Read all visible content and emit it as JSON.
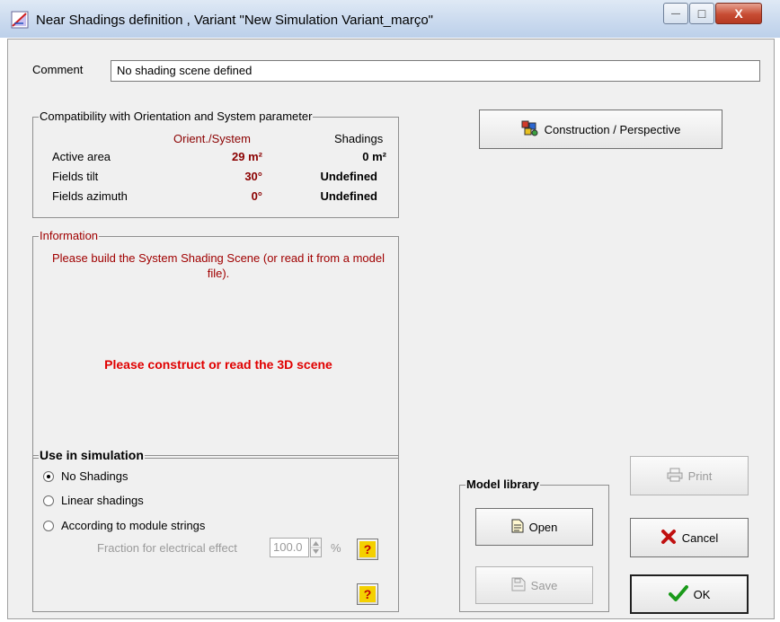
{
  "window": {
    "title": "Near Shadings definition , Variant \"New Simulation Variant_março\"",
    "minimize_glyph": "—",
    "maximize_glyph": "□",
    "close_glyph": "X"
  },
  "comment": {
    "label": "Comment",
    "value": "No shading scene defined"
  },
  "compatibility": {
    "legend": "Compatibility with Orientation and System parameter",
    "col_orient": "Orient./System",
    "col_shadings": "Shadings",
    "rows": [
      {
        "label": "Active area",
        "orient": "29 m²",
        "shadings": "0 m²"
      },
      {
        "label": "Fields tilt",
        "orient": "30°",
        "shadings": "Undefined"
      },
      {
        "label": "Fields azimuth",
        "orient": "0°",
        "shadings": "Undefined"
      }
    ]
  },
  "information": {
    "legend": "Information",
    "message": "Please build the System Shading Scene  (or read it from a model file).",
    "warning": "Please construct or read the 3D scene"
  },
  "simulation": {
    "legend": "Use in simulation",
    "options": [
      {
        "label": "No Shadings",
        "selected": true
      },
      {
        "label": "Linear shadings",
        "selected": false
      },
      {
        "label": "According to module strings",
        "selected": false
      }
    ],
    "fraction_label": "Fraction for electrical effect",
    "fraction_value": "100.0",
    "fraction_unit": "%",
    "help_glyph": "?"
  },
  "buttons": {
    "construction": "Construction / Perspective",
    "print": "Print",
    "open": "Open",
    "save": "Save",
    "cancel": "Cancel",
    "ok": "OK"
  },
  "model_library": {
    "legend": "Model library"
  },
  "colors": {
    "dark_red": "#8b0000",
    "warning_red": "#e00000",
    "info_red": "#a00000"
  },
  "icons": {
    "title": "shading-scene-icon",
    "construction": "3d-shapes-icon",
    "print": "printer-icon",
    "open": "open-file-icon",
    "save": "save-file-icon",
    "cancel": "red-x-icon",
    "ok": "green-check-icon"
  }
}
